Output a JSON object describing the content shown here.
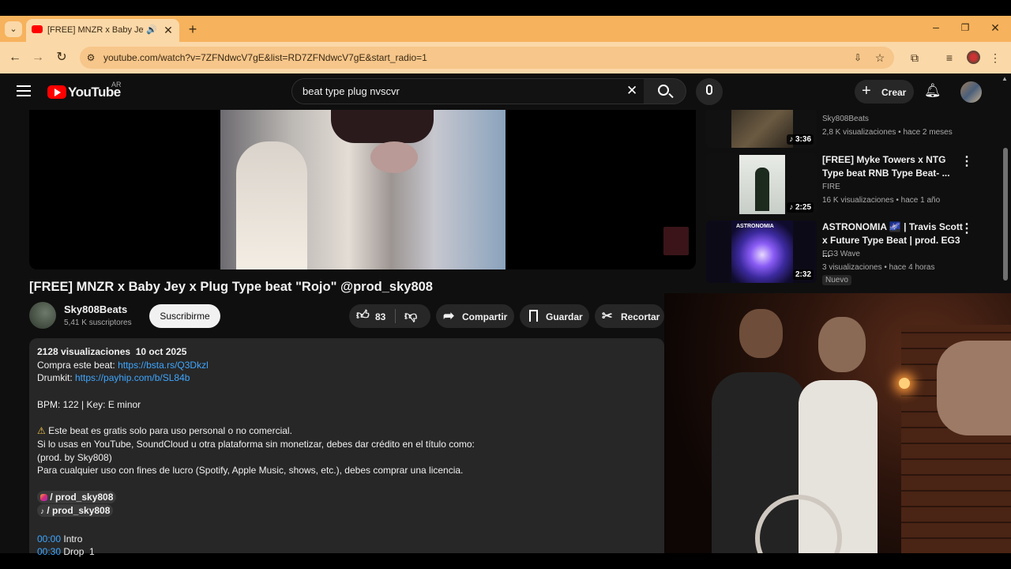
{
  "browser": {
    "tab_title": "[FREE] MNZR x Baby Jey x P",
    "url": "youtube.com/watch?v=7ZFNdwcV7gE&list=RD7ZFNdwcV7gE&start_radio=1"
  },
  "header": {
    "logo_text": "YouTube",
    "country": "AR",
    "search_value": "beat type plug nvscvr",
    "create_label": "Crear"
  },
  "video": {
    "title": "[FREE] MNZR x Baby Jey x Plug Type beat \"Rojo\" @prod_sky808",
    "channel": "Sky808Beats",
    "subscribers": "5,41 K suscriptores",
    "subscribe_label": "Suscribirme",
    "likes": "83",
    "share_label": "Compartir",
    "save_label": "Guardar",
    "clip_label": "Recortar"
  },
  "description": {
    "stats": "2128 visualizaciones  10 oct 2025",
    "buy_prefix": "Compra este beat: ",
    "buy_link": "https://bsta.rs/Q3Dkzl",
    "drum_prefix": "Drumkit: ",
    "drum_link": "https://payhip.com/b/SL84b",
    "bpm": "BPM: 122 | Key: E minor",
    "warning": "Este beat es gratis solo para uso personal o no comercial.",
    "line2": "Si lo usas en YouTube, SoundCloud u otra plataforma sin monetizar, debes dar crédito en el título como:",
    "line3": "(prod. by Sky808)",
    "line4": "Para cualquier uso con fines de lucro (Spotify, Apple Music, shows, etc.), debes comprar una licencia.",
    "ig": "/ prod_sky808",
    "tt": "/ prod_sky808",
    "ts1": "00:00",
    "ts1_label": " Intro",
    "ts2": "00:30",
    "ts2_label": " Drop  1"
  },
  "related": [
    {
      "title": "",
      "channel": "Sky808Beats",
      "meta": "2,8 K visualizaciones • hace 2 meses",
      "duration": "3:36"
    },
    {
      "title": "[FREE] Myke Towers x NTG Type beat RNB Type Beat- ...",
      "channel": "FIRE",
      "meta": "16 K visualizaciones • hace 1 año",
      "duration": "2:25"
    },
    {
      "title": "ASTRONOMIA 🌌 | Travis Scott x Future Type Beat | prod. EG3 ...",
      "channel": "EG3 Wave",
      "meta": "3 visualizaciones • hace 4 horas",
      "duration": "2:32",
      "badge": "Nuevo",
      "thumb_text": "ASTRONOMIA"
    }
  ],
  "colors": {
    "accent": "#ff0000",
    "link": "#3ea6ff",
    "chrome": "#f6b25c"
  }
}
